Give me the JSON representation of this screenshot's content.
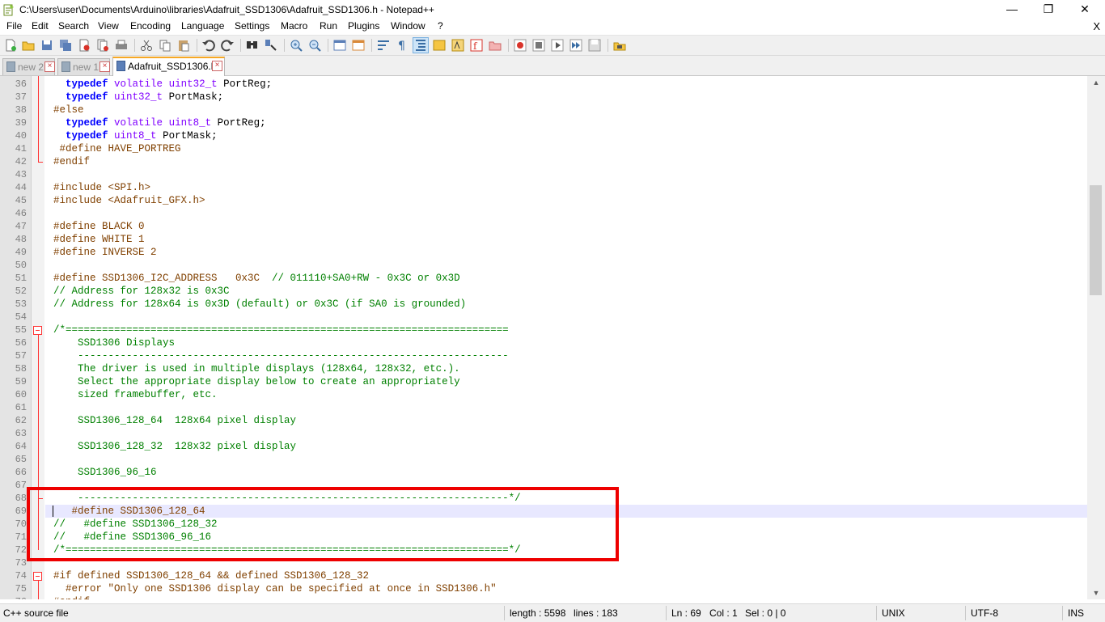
{
  "window": {
    "title": "C:\\Users\\user\\Documents\\Arduino\\libraries\\Adafruit_SSD1306\\Adafruit_SSD1306.h - Notepad++",
    "minimize": "—",
    "maximize": "❐",
    "close": "✕"
  },
  "menu": {
    "items": [
      "File",
      "Edit",
      "Search",
      "View",
      "Encoding",
      "Language",
      "Settings",
      "Macro",
      "Run",
      "Plugins",
      "Window",
      "?"
    ],
    "doc_close": "X"
  },
  "tabs": [
    {
      "label": "new 2",
      "active": false
    },
    {
      "label": "new 1",
      "active": false
    },
    {
      "label": "Adafruit_SSD1306.h",
      "active": true
    }
  ],
  "editor": {
    "current_line": 69,
    "lines": [
      {
        "n": "36",
        "parts": [
          {
            "t": "  "
          },
          {
            "c": "kw",
            "t": "typedef"
          },
          {
            "t": " "
          },
          {
            "c": "typ",
            "t": "volatile"
          },
          {
            "t": " "
          },
          {
            "c": "typ",
            "t": "uint32_t"
          },
          {
            "t": " PortReg;"
          }
        ]
      },
      {
        "n": "37",
        "parts": [
          {
            "t": "  "
          },
          {
            "c": "kw",
            "t": "typedef"
          },
          {
            "t": " "
          },
          {
            "c": "typ",
            "t": "uint32_t"
          },
          {
            "t": " PortMask;"
          }
        ]
      },
      {
        "n": "38",
        "parts": [
          {
            "c": "pre",
            "t": "#else"
          }
        ]
      },
      {
        "n": "39",
        "parts": [
          {
            "t": "  "
          },
          {
            "c": "kw",
            "t": "typedef"
          },
          {
            "t": " "
          },
          {
            "c": "typ",
            "t": "volatile"
          },
          {
            "t": " "
          },
          {
            "c": "typ",
            "t": "uint8_t"
          },
          {
            "t": " PortReg;"
          }
        ]
      },
      {
        "n": "40",
        "parts": [
          {
            "t": "  "
          },
          {
            "c": "kw",
            "t": "typedef"
          },
          {
            "t": " "
          },
          {
            "c": "typ",
            "t": "uint8_t"
          },
          {
            "t": " PortMask;"
          }
        ]
      },
      {
        "n": "41",
        "parts": [
          {
            "c": "pre",
            "t": " #define HAVE_PORTREG"
          }
        ]
      },
      {
        "n": "42",
        "parts": [
          {
            "c": "pre",
            "t": "#endif"
          }
        ]
      },
      {
        "n": "43",
        "parts": []
      },
      {
        "n": "44",
        "parts": [
          {
            "c": "pre",
            "t": "#include <SPI.h>"
          }
        ]
      },
      {
        "n": "45",
        "parts": [
          {
            "c": "pre",
            "t": "#include <Adafruit_GFX.h>"
          }
        ]
      },
      {
        "n": "46",
        "parts": []
      },
      {
        "n": "47",
        "parts": [
          {
            "c": "pre",
            "t": "#define BLACK 0"
          }
        ]
      },
      {
        "n": "48",
        "parts": [
          {
            "c": "pre",
            "t": "#define WHITE 1"
          }
        ]
      },
      {
        "n": "49",
        "parts": [
          {
            "c": "pre",
            "t": "#define INVERSE 2"
          }
        ]
      },
      {
        "n": "50",
        "parts": []
      },
      {
        "n": "51",
        "parts": [
          {
            "c": "pre",
            "t": "#define SSD1306_I2C_ADDRESS   0x3C  "
          },
          {
            "c": "cmt",
            "t": "// 011110+SA0+RW - 0x3C or 0x3D"
          }
        ]
      },
      {
        "n": "52",
        "parts": [
          {
            "c": "cmt",
            "t": "// Address for 128x32 is 0x3C"
          }
        ]
      },
      {
        "n": "53",
        "parts": [
          {
            "c": "cmt",
            "t": "// Address for 128x64 is 0x3D (default) or 0x3C (if SA0 is grounded)"
          }
        ]
      },
      {
        "n": "54",
        "parts": []
      },
      {
        "n": "55",
        "parts": [
          {
            "c": "cmt",
            "t": "/*========================================================================="
          }
        ]
      },
      {
        "n": "56",
        "parts": [
          {
            "c": "cmt",
            "t": "    SSD1306 Displays"
          }
        ]
      },
      {
        "n": "57",
        "parts": [
          {
            "c": "cmt",
            "t": "    -----------------------------------------------------------------------"
          }
        ]
      },
      {
        "n": "58",
        "parts": [
          {
            "c": "cmt",
            "t": "    The driver is used in multiple displays (128x64, 128x32, etc.)."
          }
        ]
      },
      {
        "n": "59",
        "parts": [
          {
            "c": "cmt",
            "t": "    Select the appropriate display below to create an appropriately"
          }
        ]
      },
      {
        "n": "60",
        "parts": [
          {
            "c": "cmt",
            "t": "    sized framebuffer, etc."
          }
        ]
      },
      {
        "n": "61",
        "parts": []
      },
      {
        "n": "62",
        "parts": [
          {
            "c": "cmt",
            "t": "    SSD1306_128_64  128x64 pixel display"
          }
        ]
      },
      {
        "n": "63",
        "parts": []
      },
      {
        "n": "64",
        "parts": [
          {
            "c": "cmt",
            "t": "    SSD1306_128_32  128x32 pixel display"
          }
        ]
      },
      {
        "n": "65",
        "parts": []
      },
      {
        "n": "66",
        "parts": [
          {
            "c": "cmt",
            "t": "    SSD1306_96_16"
          }
        ]
      },
      {
        "n": "67",
        "parts": []
      },
      {
        "n": "68",
        "parts": [
          {
            "c": "cmt",
            "t": "    -----------------------------------------------------------------------*/"
          }
        ]
      },
      {
        "n": "69",
        "parts": [
          {
            "c": "pre",
            "t": "   #define SSD1306_128_64"
          }
        ]
      },
      {
        "n": "70",
        "parts": [
          {
            "c": "cmt",
            "t": "//   #define SSD1306_128_32"
          }
        ]
      },
      {
        "n": "71",
        "parts": [
          {
            "c": "cmt",
            "t": "//   #define SSD1306_96_16"
          }
        ]
      },
      {
        "n": "72",
        "parts": [
          {
            "c": "cmt",
            "t": "/*=========================================================================*/"
          }
        ]
      },
      {
        "n": "73",
        "parts": []
      },
      {
        "n": "74",
        "parts": [
          {
            "c": "pre",
            "t": "#if defined SSD1306_128_64 && defined SSD1306_128_32"
          }
        ]
      },
      {
        "n": "75",
        "parts": [
          {
            "c": "pre",
            "t": "  #error \"Only one SSD1306 display can be specified at once in SSD1306.h\""
          }
        ]
      },
      {
        "n": "76",
        "parts": [
          {
            "c": "pre",
            "t": "#endif"
          }
        ]
      }
    ]
  },
  "status": {
    "file_type": "C++ source file",
    "length": "length : 5598",
    "lines": "lines : 183",
    "ln": "Ln : 69",
    "col": "Col : 1",
    "sel": "Sel : 0 | 0",
    "eol": "UNIX",
    "encoding": "UTF-8",
    "mode": "INS"
  },
  "colors": {
    "keyword": "#0000ff",
    "type": "#8000ff",
    "preprocessor": "#804000",
    "comment": "#008000",
    "annotation": "#ee0000",
    "active_tab_accent": "#f7a825"
  }
}
